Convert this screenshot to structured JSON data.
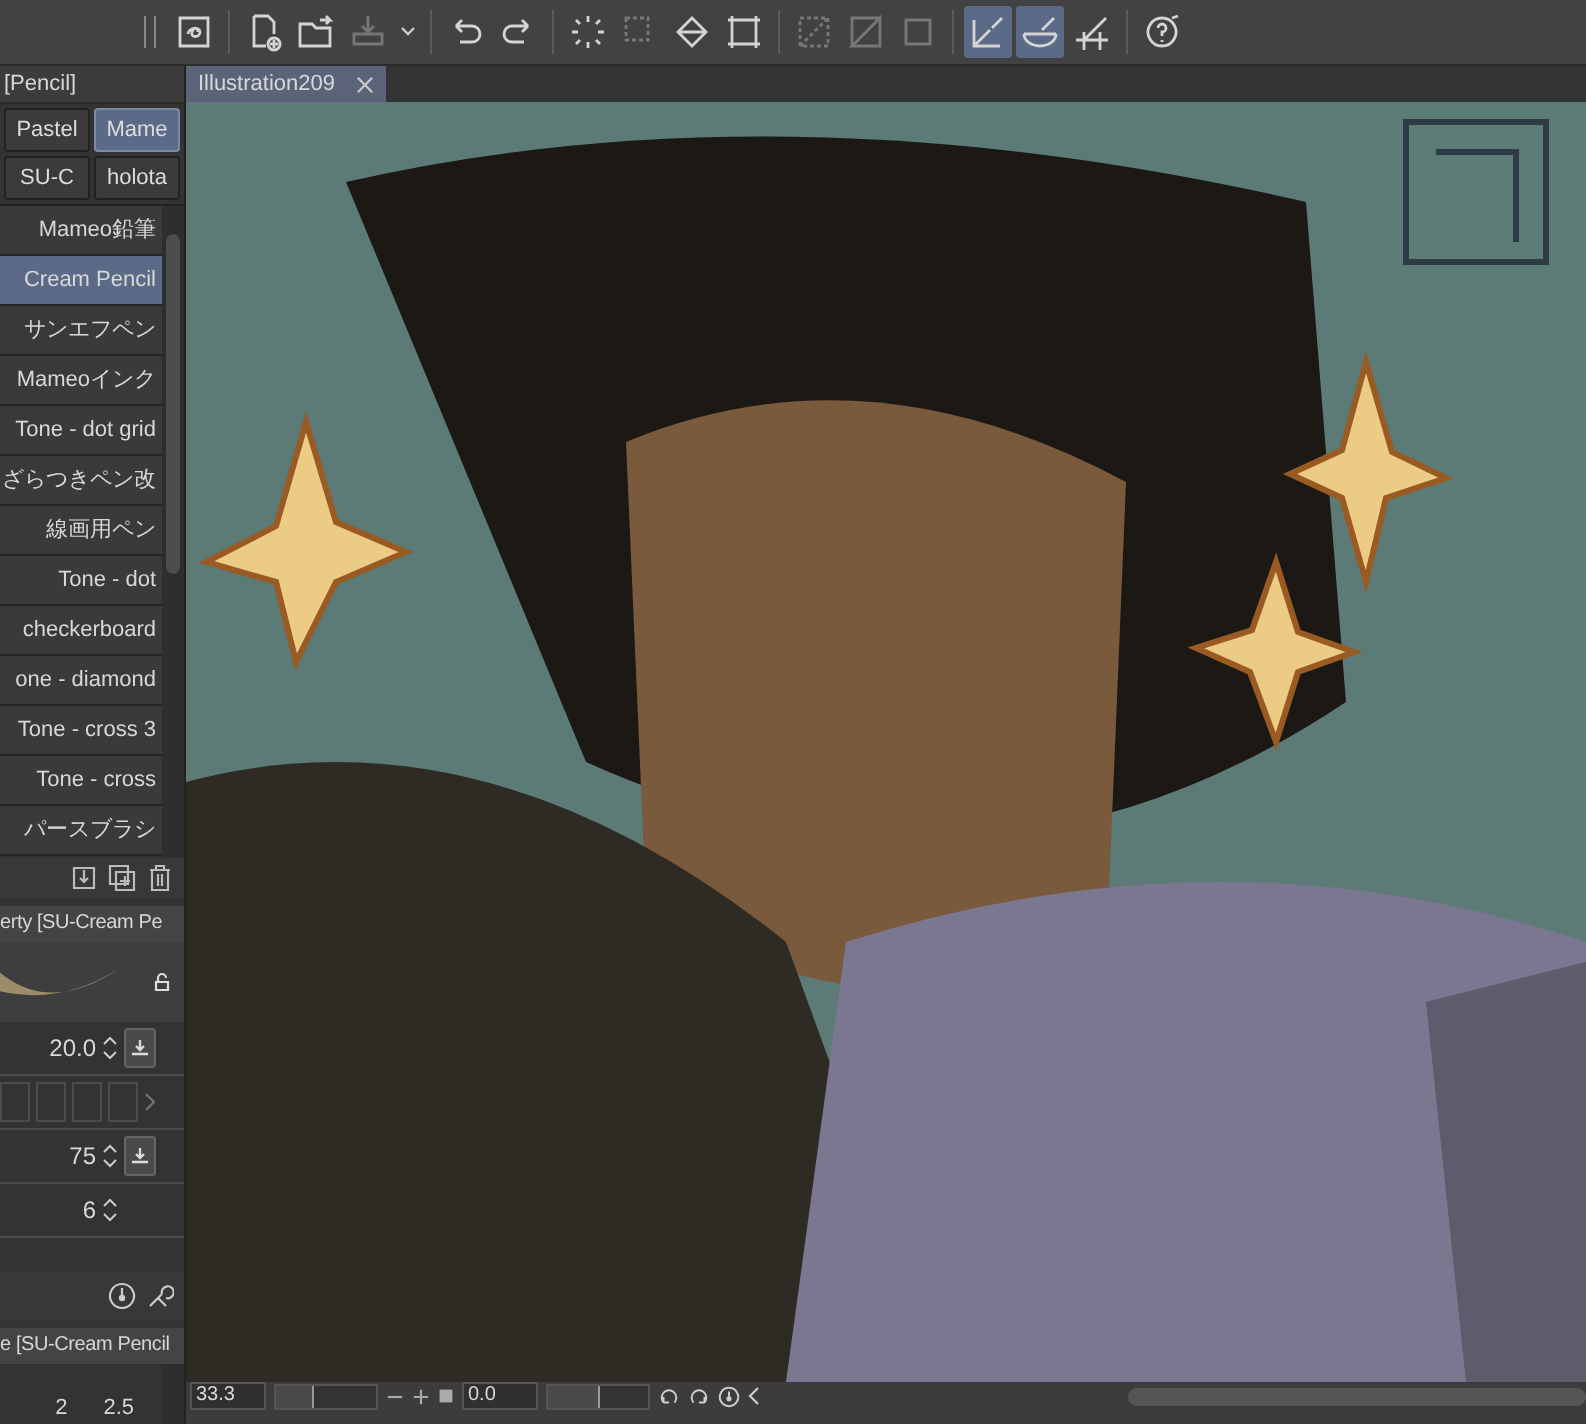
{
  "toolbar": {
    "buttons": [
      {
        "disabled": false,
        "selected": false
      },
      {
        "disabled": false,
        "selected": false
      },
      {
        "disabled": false,
        "selected": false
      },
      {
        "disabled": true,
        "selected": false
      },
      {
        "disabled": false,
        "selected": false
      },
      {
        "disabled": false,
        "selected": false
      },
      {
        "disabled": false,
        "selected": false
      },
      {
        "disabled": true,
        "selected": false
      },
      {
        "disabled": false,
        "selected": false
      },
      {
        "disabled": false,
        "selected": false
      },
      {
        "disabled": true,
        "selected": false
      },
      {
        "disabled": true,
        "selected": false
      },
      {
        "disabled": true,
        "selected": false
      },
      {
        "disabled": false,
        "selected": true
      },
      {
        "disabled": false,
        "selected": true
      },
      {
        "disabled": false,
        "selected": false
      },
      {
        "disabled": false,
        "selected": false
      }
    ]
  },
  "sub_tool": {
    "tab": "[Pencil]",
    "groups": [
      {
        "label": "Pastel",
        "selected": false
      },
      {
        "label": "Mame",
        "selected": true
      },
      {
        "label": "SU-C",
        "selected": false
      },
      {
        "label": "holota",
        "selected": false
      }
    ],
    "brushes": [
      {
        "label": "Mameo鉛筆",
        "selected": false
      },
      {
        "label": "Cream Pencil",
        "selected": true
      },
      {
        "label": "サンエフペン",
        "selected": false
      },
      {
        "label": "Mameoインク",
        "selected": false
      },
      {
        "label": "Tone - dot grid",
        "selected": false
      },
      {
        "label": "ざらつきペン改",
        "selected": false
      },
      {
        "label": "線画用ペン",
        "selected": false
      },
      {
        "label": "Tone - dot",
        "selected": false
      },
      {
        "label": "checkerboard",
        "selected": false
      },
      {
        "label": "one - diamond",
        "selected": false
      },
      {
        "label": "Tone - cross 3",
        "selected": false
      },
      {
        "label": "Tone - cross",
        "selected": false
      },
      {
        "label": "パースブラシ",
        "selected": false
      }
    ]
  },
  "tool_property": {
    "title": "erty [SU-Cream Pe",
    "fields": [
      {
        "kind": "number",
        "value": "20.0",
        "button": true
      },
      {
        "kind": "swatches"
      },
      {
        "kind": "number",
        "value": "75",
        "button": true
      },
      {
        "kind": "number",
        "value": "6",
        "button": false
      }
    ]
  },
  "brush_size": {
    "title": "e [SU-Cream Pencil",
    "sizes": [
      "2",
      "2.5"
    ]
  },
  "document_tab": {
    "title": "Illustration209"
  },
  "navigator": {
    "zoom": "33.3",
    "zoom_slider": {
      "level": 0.35
    },
    "rotation": "0.0",
    "rotation_slider": {
      "level": 0.5
    }
  }
}
